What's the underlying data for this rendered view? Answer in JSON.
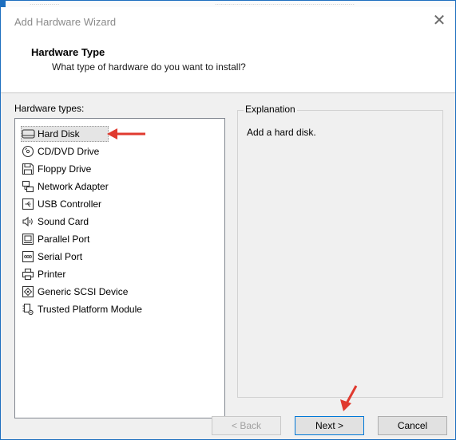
{
  "window": {
    "title": "Add Hardware Wizard",
    "close_glyph": "✕",
    "accent_color": "#1e6fbf",
    "background_ghost_text_left": "...............",
    "background_ghost_text_right": "......................................................................"
  },
  "header": {
    "title": "Hardware Type",
    "subtitle": "What type of hardware do you want to install?"
  },
  "hardware_list": {
    "label": "Hardware types:",
    "selected_index": 0,
    "items": [
      {
        "label": "Hard Disk",
        "icon": "hard-disk-icon"
      },
      {
        "label": "CD/DVD Drive",
        "icon": "cd-dvd-icon"
      },
      {
        "label": "Floppy Drive",
        "icon": "floppy-icon"
      },
      {
        "label": "Network Adapter",
        "icon": "network-adapter-icon"
      },
      {
        "label": "USB Controller",
        "icon": "usb-icon"
      },
      {
        "label": "Sound Card",
        "icon": "speaker-icon"
      },
      {
        "label": "Parallel Port",
        "icon": "parallel-port-icon"
      },
      {
        "label": "Serial Port",
        "icon": "serial-port-icon"
      },
      {
        "label": "Printer",
        "icon": "printer-icon"
      },
      {
        "label": "Generic SCSI Device",
        "icon": "scsi-device-icon"
      },
      {
        "label": "Trusted Platform Module",
        "icon": "tpm-icon"
      }
    ]
  },
  "explanation": {
    "label": "Explanation",
    "text": "Add a hard disk."
  },
  "buttons": {
    "back": "< Back",
    "next": "Next >",
    "cancel": "Cancel"
  },
  "annotation": {
    "arrow_color": "#e03a2f"
  }
}
